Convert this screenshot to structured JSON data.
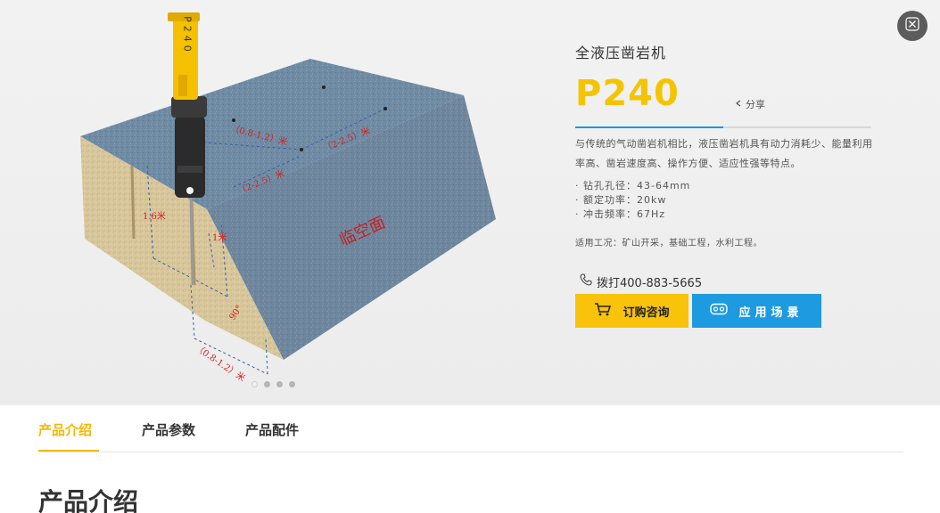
{
  "header": {
    "product_type": "全液压凿岩机",
    "model": "P240",
    "share_label": "分享"
  },
  "description": "与传统的气动凿岩机相比，液压凿岩机具有动力消耗少、能量利用率高、凿岩速度高、操作方便、适应性强等特点。",
  "specs": [
    "· 钻孔孔径：43-64mm",
    "· 额定功率：20kw",
    "· 冲击频率：67Hz"
  ],
  "usage": "适用工况：矿山开采，基础工程，水利工程。",
  "contact": {
    "phone_label": "拨打400-883-5665"
  },
  "buttons": {
    "order": "订购咨询",
    "scene": "应用场景"
  },
  "illustration": {
    "drill_label": "P240",
    "dims": {
      "top_spacing_1": "（0.8-1.2）米",
      "top_spacing_2": "（2-2.5）米",
      "burden": "（2-2.5）米",
      "depth": "1.6米",
      "sub_drill": "1米",
      "bottom_spacing": "（0.8-1.2）米",
      "angle": "90°"
    },
    "free_face": "临空面"
  },
  "carousel": {
    "count": 4,
    "active": 0
  },
  "tabs": [
    {
      "label": "产品介绍",
      "active": true
    },
    {
      "label": "产品参数",
      "active": false
    },
    {
      "label": "产品配件",
      "active": false
    }
  ],
  "section": {
    "title": "产品介绍"
  },
  "colors": {
    "accent_yellow": "#f5c400",
    "accent_blue": "#1e9ae0",
    "dimension_red": "#d42020"
  }
}
